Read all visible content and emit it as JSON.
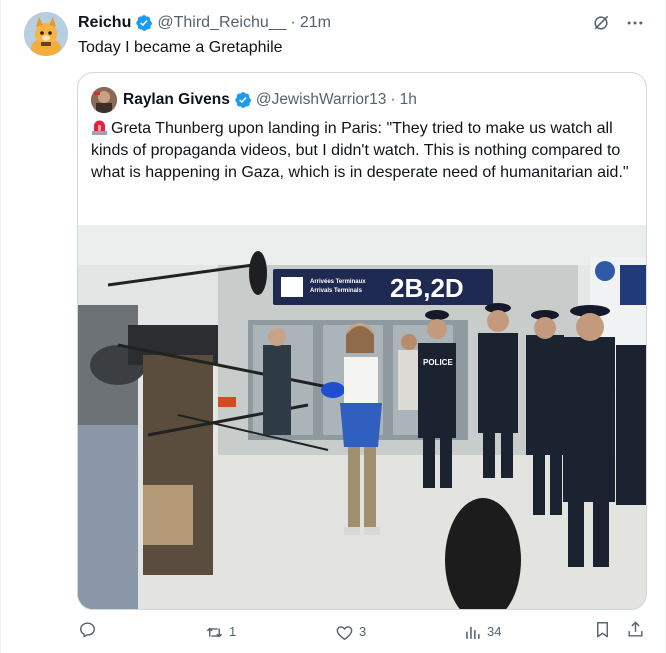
{
  "tweet": {
    "author_name": "Reichu",
    "author_handle": "@Third_Reichu__",
    "separator": "·",
    "time": "21m",
    "text": "Today I became a Gretaphile"
  },
  "quote": {
    "author_name": "Raylan Givens",
    "author_handle": "@JewishWarrior13",
    "separator": "·",
    "time": "1h",
    "text": "Greta Thunberg upon landing in Paris: \"They tried to make us watch all kinds of propaganda videos, but I didn't watch. This is nothing compared to what is happening in Gaza, which is in desperate need of humanitarian aid.\"",
    "image": {
      "sign_line1": "Arrivées Terminaux",
      "sign_line2": "Arrivals Terminals",
      "sign_terminal": "2B,2D",
      "police_label": "POLICE"
    }
  },
  "actions": {
    "reply_count": "",
    "repost_count": "1",
    "like_count": "3",
    "views_count": "34"
  },
  "icons": {
    "verified": "verified-badge-icon",
    "grok": "grok-slash-icon",
    "more": "more-icon",
    "reply": "reply-icon",
    "repost": "repost-icon",
    "like": "like-icon",
    "views": "views-icon",
    "bookmark": "bookmark-icon",
    "share": "share-icon",
    "siren": "siren-emoji"
  },
  "colors": {
    "verified_blue": "#1d9bf0",
    "text_primary": "#0f1419",
    "text_secondary": "#536471",
    "border": "#cfd9de"
  }
}
